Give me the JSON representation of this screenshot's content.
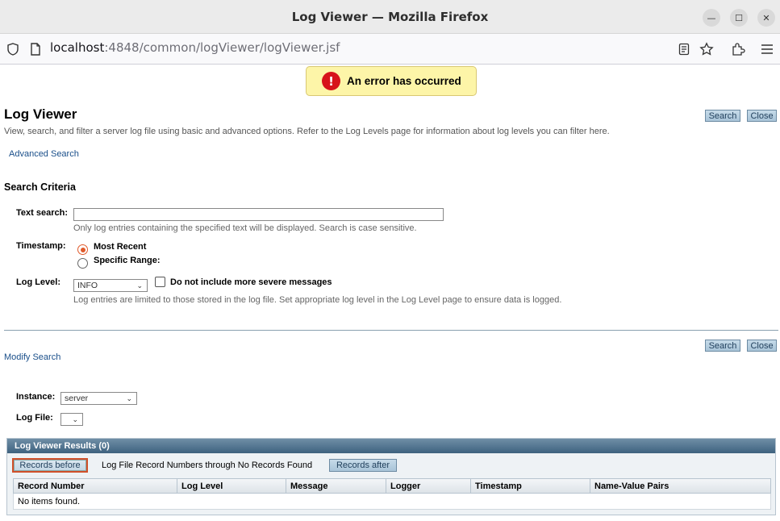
{
  "window": {
    "title": "Log Viewer — Mozilla Firefox",
    "minimize_glyph": "—",
    "maximize_glyph": "☐",
    "close_glyph": "✕"
  },
  "navbar": {
    "url_host": "localhost",
    "url_rest": ":4848/common/logViewer/logViewer.jsf"
  },
  "error": {
    "message": "An error has occurred",
    "icon_glyph": "!"
  },
  "page": {
    "title": "Log Viewer",
    "description": "View, search, and filter a server log file using basic and advanced options. Refer to the Log Levels page for information about log levels you can filter here.",
    "advanced_search_link": "Advanced Search",
    "search_button": "Search",
    "close_button": "Close"
  },
  "criteria": {
    "heading": "Search Criteria",
    "text_search_label": "Text search:",
    "text_search_value": "",
    "text_search_help": "Only log entries containing the specified text will be displayed. Search is case sensitive.",
    "timestamp_label": "Timestamp:",
    "most_recent": "Most Recent",
    "specific_range": "Specific Range:",
    "log_level_label": "Log Level:",
    "log_level_value": "INFO",
    "no_severe_label": "Do not include more severe messages",
    "log_level_help": "Log entries are limited to those stored in the log file. Set appropriate log level in the Log Level page to ensure data is logged."
  },
  "modify": {
    "link": "Modify Search",
    "search_button": "Search",
    "close_button": "Close",
    "instance_label": "Instance:",
    "instance_value": "server",
    "log_file_label": "Log File:",
    "log_file_value": ""
  },
  "results": {
    "heading": "Log Viewer Results (0)",
    "records_before": "Records before",
    "record_numbers_text": "Log File Record Numbers through No Records Found",
    "records_after": "Records after",
    "columns": [
      "Record Number",
      "Log Level",
      "Message",
      "Logger",
      "Timestamp",
      "Name-Value Pairs"
    ],
    "empty_text": "No items found."
  },
  "colors": {
    "error_background": "#fdf5a8",
    "error_icon": "#d7131a",
    "link": "#1a4f8a",
    "results_header": "#3e627f",
    "radio_selected": "#e05a2b",
    "focus_outline": "#d0502a"
  }
}
